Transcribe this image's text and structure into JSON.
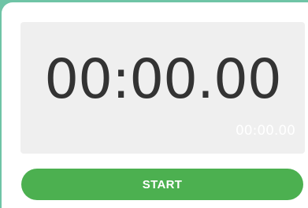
{
  "stopwatch": {
    "main_time": "00:00.00",
    "lap_time": "00:00.00",
    "start_label": "START"
  },
  "colors": {
    "background_accent": "#6fc4a6",
    "panel": "#efefef",
    "time_text": "#333333",
    "button": "#4cb050",
    "button_text": "#ffffff"
  }
}
